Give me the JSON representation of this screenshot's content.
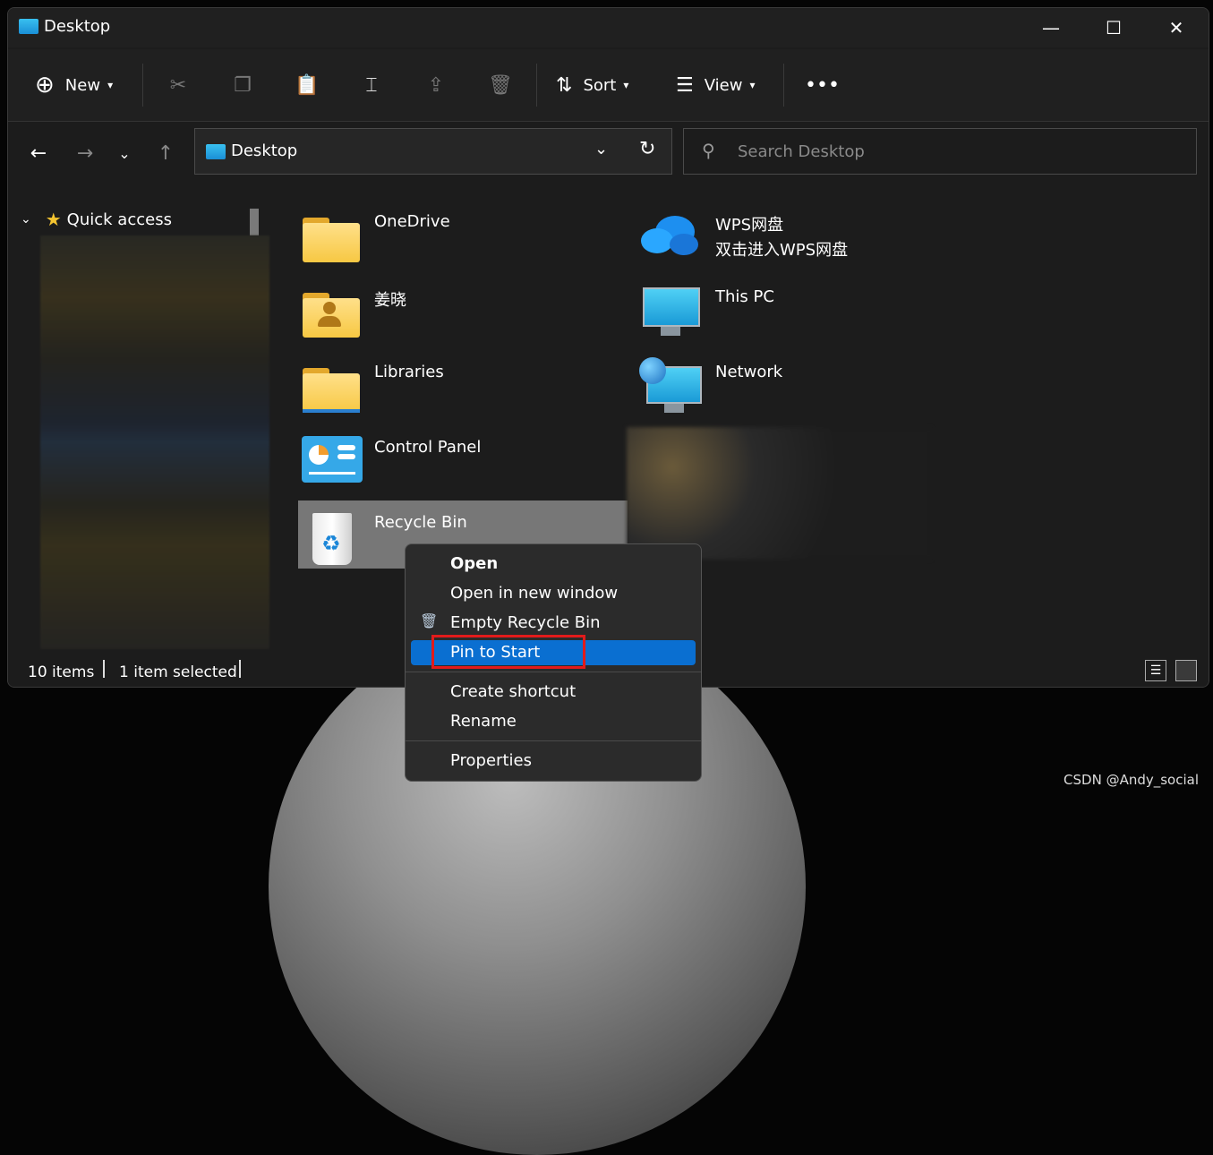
{
  "window": {
    "title": "Desktop"
  },
  "toolbar": {
    "new_label": "New",
    "sort_label": "Sort",
    "view_label": "View"
  },
  "address": {
    "path": "Desktop"
  },
  "search": {
    "placeholder": "Search Desktop"
  },
  "sidebar": {
    "quick_access_label": "Quick access"
  },
  "items": {
    "onedrive": "OneDrive",
    "wps": "WPS网盘",
    "wps_sub": "双击进入WPS网盘",
    "user": "姜晓",
    "thispc": "This PC",
    "libraries": "Libraries",
    "network": "Network",
    "controlpanel": "Control Panel",
    "recyclebin": "Recycle Bin"
  },
  "status": {
    "item_count": "10 items",
    "selected": "1 item selected"
  },
  "context_menu": {
    "open": "Open",
    "open_new_window": "Open in new window",
    "empty_recycle_bin": "Empty Recycle Bin",
    "pin_to_start": "Pin to Start",
    "create_shortcut": "Create shortcut",
    "rename": "Rename",
    "properties": "Properties"
  },
  "watermark": "CSDN @Andy_social",
  "colors": {
    "highlight": "#0a6fd1",
    "annotation_box": "#e21b1b"
  }
}
